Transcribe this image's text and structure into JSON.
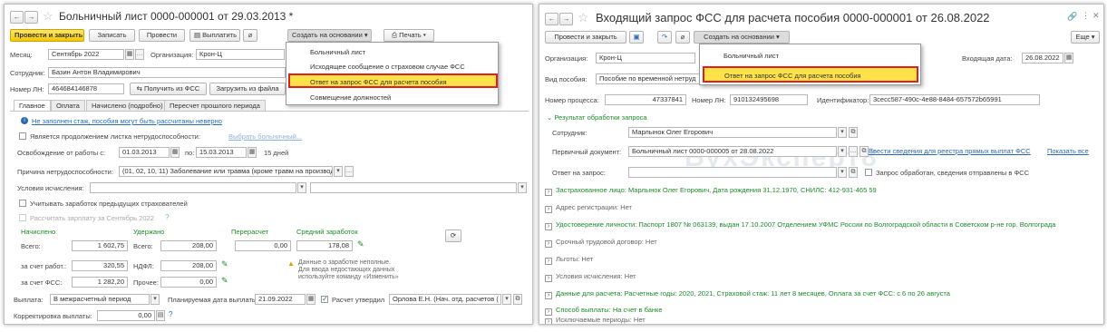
{
  "left": {
    "title": "Больничный лист 0000-000001 от 29.03.2013 *",
    "toolbar": {
      "post_close": "Провести и закрыть",
      "save": "Записать",
      "post": "Провести",
      "pay": "Выплатить",
      "create_based": "Создать на основании",
      "print": "Печать"
    },
    "menu": [
      "Больничный лист",
      "Исходящее сообщение о страховом случае ФСС",
      "Ответ на запрос ФСС для расчета пособия",
      "Совмещение должностей"
    ],
    "month_label": "Месяц:",
    "month": "Сентябрь 2022",
    "org_label": "Организация:",
    "org": "Крон-Ц",
    "employee_label": "Сотрудник:",
    "employee": "Базин Антон Владимирович",
    "ln_label": "Номер ЛН:",
    "ln": "464684146878",
    "get_fss": "Получить из ФСС",
    "load_file": "Загрузить из файла",
    "tabs": [
      "Главное",
      "Оплата",
      "Начислено (подробно)",
      "Пересчет прошлого периода"
    ],
    "warning": "Не заполнен стаж, пособия могут быть рассчитаны неверно",
    "continuation": "Является продолжением листка нетрудоспособности:",
    "choose_sick": "Выбрать больничный...",
    "release_label": "Освобождение от работы с:",
    "from": "01.03.2013",
    "to_label": "по:",
    "to": "15.03.2013",
    "days": "15 дней",
    "cause_label": "Причина нетрудоспособности:",
    "cause": "(01, 02, 10, 11) Заболевание или травма (кроме травм на производс",
    "calc_label": "Условия исчисления:",
    "prev_insurers": "Учитывать заработок предыдущих страхователей",
    "calc_salary": "Рассчитать зарплату за Сентябрь 2022",
    "h_accrued": "Начислено",
    "h_withheld": "Удержано",
    "h_recalc": "Перерасчет",
    "h_avg": "Средний заработок",
    "total_label": "Всего:",
    "total": "1 602,75",
    "withheld_total_label": "Всего:",
    "withheld_total": "208,00",
    "recalc": "0,00",
    "avg": "178,08",
    "employer_label": "за счет работ.:",
    "employer": "320,55",
    "ndfl_label": "НДФЛ:",
    "ndfl": "208,00",
    "fss_label": "за счет ФСС:",
    "fss": "1 282,20",
    "other_label": "Прочее:",
    "other": "0,00",
    "note": "Данные о заработке неполные.\nДля ввода недостающих данных\nиспользуйте команду «Изменить»",
    "payout_label": "Выплата:",
    "payout": "В межрасчетный период",
    "planned_label": "Планируемая дата выплаты:",
    "planned": "21.09.2022",
    "approved_label": "Расчет утвердил",
    "approver": "Орлова Е.Н. (Нач. отд. расчетов (",
    "adjust_label": "Корректировка выплаты:",
    "adjust": "0,00"
  },
  "right": {
    "title": "Входящий запрос ФСС для расчета пособия 0000-000001 от 26.08.2022",
    "toolbar": {
      "post_close": "Провести и закрыть",
      "create_based": "Создать на основании",
      "more": "Еще"
    },
    "menu": [
      "Больничный лист",
      "Ответ на запрос ФСС для расчета пособия"
    ],
    "org_label": "Организация:",
    "org": "Крон-Ц",
    "incoming_label": "Входящая дата:",
    "incoming": "26.08.2022",
    "benefit_label": "Вид пособия:",
    "benefit": "Пособие по временной нетруд",
    "proc_label": "Номер процесса:",
    "proc": "47337841",
    "ln_label": "Номер ЛН:",
    "ln": "910132495698",
    "id_label": "Идентификатор:",
    "id": "3cecc587-490c-4e88-8484-657572b65991",
    "result_header": "Результат обработки запроса",
    "employee_label": "Сотрудник:",
    "employee": "Марлынок Олег Егорович",
    "primary_label": "Первичный документ:",
    "primary": "Больничный лист 0000-000005 от 28.08.2022",
    "enter_registry": "Ввести сведения для реестра прямых выплат ФСС",
    "show_all": "Показать все",
    "reply_label": "Ответ на запрос:",
    "processed": "Запрос обработан, сведения отправлены в ФСС",
    "sections": [
      {
        "text": "Застрахованное лицо: Марлынок Олег Егорович, Дата рождения 31.12.1970, СНИЛС: 412-931-465 59",
        "green": true
      },
      {
        "text": "Адрес регистрации: Нет",
        "green": false
      },
      {
        "text": "Удостоверение личности: Паспорт 1807 № 063139, выдан 17.10.2007 Отделением УФМС России по Волгоградской области в Советском р-не гор. Волгограда",
        "green": true
      },
      {
        "text": "Срочный трудовой договор: Нет",
        "green": false
      },
      {
        "text": "Льготы: Нет",
        "green": false
      },
      {
        "text": "Условия исчисления: Нет",
        "green": false
      },
      {
        "text": "Данные для расчета: Расчетные годы: 2020, 2021, Страховой стаж: 11 лет 8 месяцев, Оплата за счет ФСС: с 6 по 26 августа",
        "green": true
      },
      {
        "text": "Способ выплаты: На счет в банке",
        "green": true
      },
      {
        "text": "Исключаемые периоды: Нет",
        "green": false
      }
    ],
    "watermark": "БухЭксперт8"
  },
  "colors": {
    "highlight": "#ffe14a",
    "highlight_border": "#e02020",
    "green": "#1d8a2b",
    "link": "#2a6ab3",
    "yellow_button": "#f5c800"
  }
}
